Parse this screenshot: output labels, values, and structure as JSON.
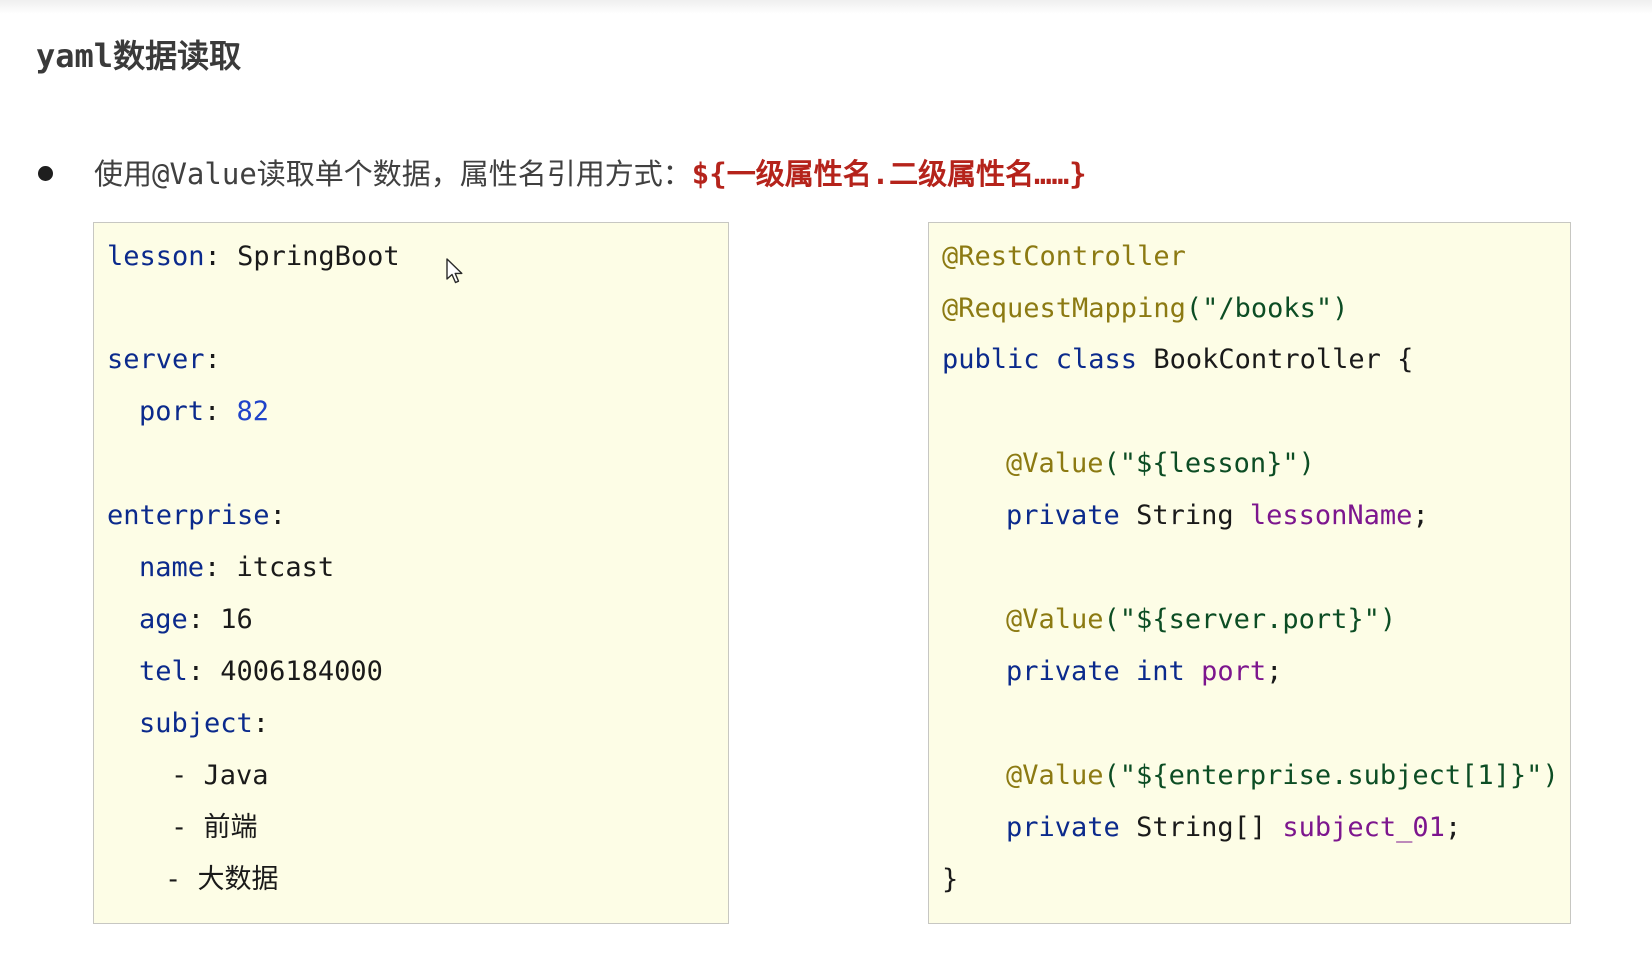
{
  "slide": {
    "title_prefix": "yaml",
    "title_suffix": "数据读取",
    "bullet": {
      "text_before": "使用",
      "text_mono": "@Value",
      "text_after": "读取单个数据，属性名引用方式：",
      "highlight": "${一级属性名.二级属性名……}"
    }
  },
  "yaml_code": {
    "lesson_key": "lesson",
    "lesson_value": "SpringBoot",
    "server_key": "server",
    "port_key": "port",
    "port_value": "82",
    "enterprise_key": "enterprise",
    "name_key": "name",
    "name_value": "itcast",
    "age_key": "age",
    "age_value": "16",
    "tel_key": "tel",
    "tel_value": "4006184000",
    "subject_key": "subject",
    "subject_items": [
      "Java",
      "前端",
      "大数据"
    ]
  },
  "java_code": {
    "annotation_rest": "@RestController",
    "annotation_mapping": "@RequestMapping",
    "mapping_value": "(\"/books\")",
    "class_keywords": "public class",
    "class_name": "BookController {",
    "value_annotation": "@Value",
    "value_1_arg": "(\"${lesson}\")",
    "field_1_keyword": "private",
    "field_1_type": "String",
    "field_1_name": "lessonName",
    "value_2_arg": "(\"${server.port}\")",
    "field_2_keyword": "private int",
    "field_2_name": "port",
    "value_3_arg": "(\"${enterprise.subject[1]}\")",
    "field_3_keyword": "private",
    "field_3_type": "String[]",
    "field_3_name": "subject_01",
    "closing_brace": "}"
  },
  "colors": {
    "panel_background": "#fdfde6",
    "highlight_red": "#b5231b",
    "keyword_blue": "#0b2a8c",
    "annotation_olive": "#8c7a12",
    "field_purple": "#7d168e",
    "string_green": "#0c4d24"
  }
}
